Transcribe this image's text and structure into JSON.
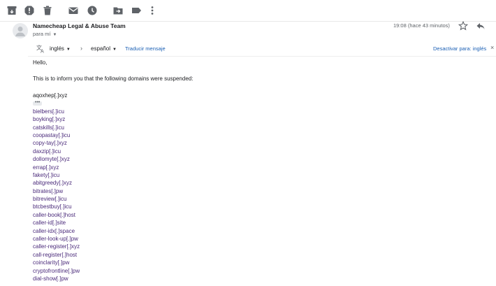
{
  "toolbar": {
    "icons": [
      "archive-icon",
      "report-spam-icon",
      "delete-icon",
      "mark-unread-icon",
      "snooze-icon",
      "move-to-icon",
      "label-icon",
      "more-icon"
    ]
  },
  "message": {
    "sender": "Namecheap Legal & Abuse Team",
    "recipient": "para mí",
    "timestamp": "19:08 (hace 43 minutos)"
  },
  "translate": {
    "from_lang": "inglés",
    "to_lang": "español",
    "translate_link": "Traducir mensaje",
    "disable_link": "Desactivar para: inglés",
    "close": "×"
  },
  "body": {
    "greeting": "Hello,",
    "intro": "This is to inform you that the following domains were suspended:",
    "first_domain": "aqoxhep[.]xyz",
    "collapsed_marker": "•••",
    "domains": [
      "bielbers[.]icu",
      "boyking[.]xyz",
      "catskills[.]icu",
      "coopastay[.]icu",
      "copy-tay[.]xyz",
      "daxzip[.]icu",
      "dollomyte[.]xyz",
      "errap[.]xyz",
      "fakety[.]icu",
      "abitgreedy[.]xyz",
      "bitrates[.]pw",
      "bitreview[.]icu",
      "btcbestbuy[.]icu",
      "caller-book[.]host",
      "caller-id[.]site",
      "caller-idx[.]space",
      "caller-look-up[.]pw",
      "caller-register[.]xyz",
      "call-register[.]host",
      "coinclarity[.]pw",
      "cryptofrontline[.]pw",
      "dial-show[.]pw"
    ]
  },
  "colors": {
    "link": "#1a5fb4",
    "domain_text": "#4a2a7a",
    "icon": "#5f6368"
  }
}
